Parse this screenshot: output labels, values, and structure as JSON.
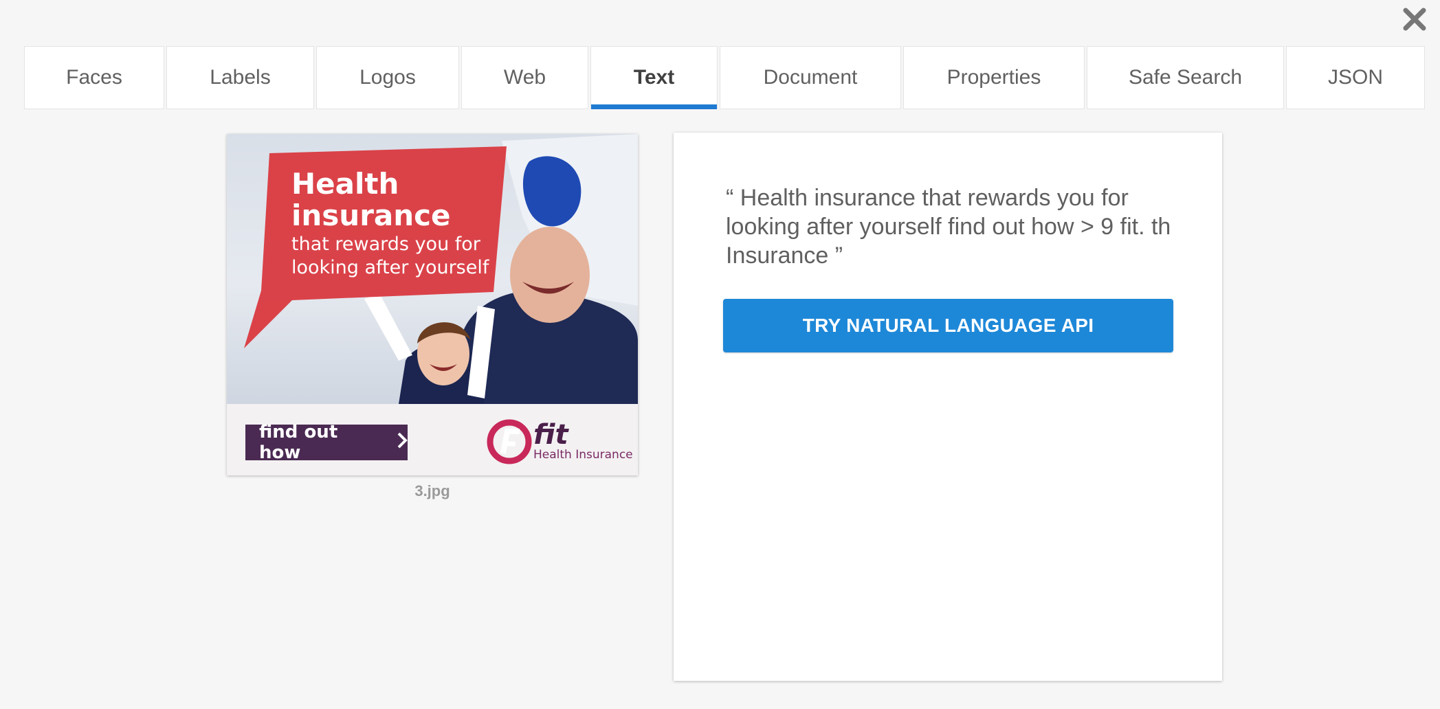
{
  "tabs": [
    {
      "label": "Faces"
    },
    {
      "label": "Labels"
    },
    {
      "label": "Logos"
    },
    {
      "label": "Web"
    },
    {
      "label": "Text",
      "active": true
    },
    {
      "label": "Document"
    },
    {
      "label": "Properties"
    },
    {
      "label": "Safe Search"
    },
    {
      "label": "JSON"
    }
  ],
  "image": {
    "filename": "3.jpg",
    "ad": {
      "headline_line1": "Health",
      "headline_line2": "insurance",
      "subline1": "that rewards you for",
      "subline2": "looking after yourself",
      "cta": "find out how",
      "brand": "fit",
      "brand_sub": "Health Insurance"
    }
  },
  "result": {
    "detected_text": "“ Health insurance that rewards you for looking after yourself find out how > 9 fit. th Insurance ”",
    "button_label": "TRY NATURAL LANGUAGE API"
  },
  "colors": {
    "accent": "#1f7ad1",
    "button": "#1e88d8",
    "ad_red": "#d9393f",
    "ad_purple": "#4a2a52"
  },
  "icons": {
    "close": "close-icon",
    "cta_arrow": "chevron-right-icon"
  }
}
